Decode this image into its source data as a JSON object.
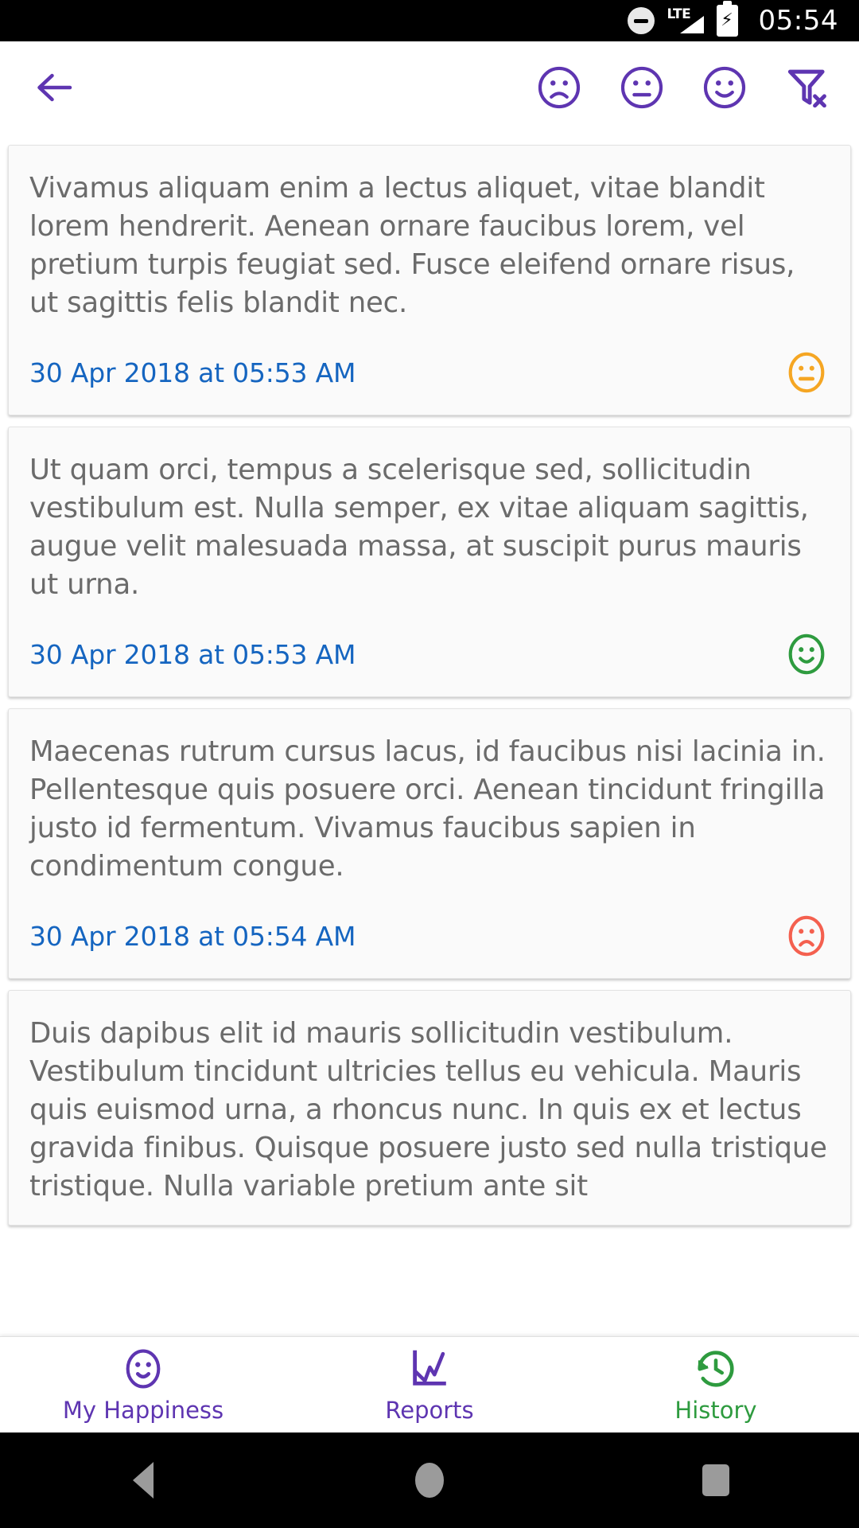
{
  "status_bar": {
    "dnd_icon": "do-not-disturb-icon",
    "network_label": "LTE",
    "signal_icon": "signal-bars-icon",
    "battery_icon": "battery-charging-icon",
    "time": "05:54"
  },
  "toolbar": {
    "back_icon": "back-arrow-icon",
    "accent_color": "#5e35b1",
    "actions": [
      {
        "name": "filter-sad-face-button",
        "icon": "sad-face-icon",
        "label": "Sad"
      },
      {
        "name": "filter-neutral-face-button",
        "icon": "neutral-face-icon",
        "label": "Neutral"
      },
      {
        "name": "filter-happy-face-button",
        "icon": "happy-face-icon",
        "label": "Happy"
      },
      {
        "name": "clear-filter-button",
        "icon": "filter-off-icon",
        "label": "Clear filter"
      }
    ]
  },
  "entries": [
    {
      "text": "Vivamus aliquam enim a lectus aliquet, vitae blandit lorem hendrerit. Aenean ornare faucibus lorem, vel pretium turpis feugiat sed. Fusce eleifend ornare risus, ut sagittis felis blandit nec.",
      "date": "30 Apr 2018 at 05:53 AM",
      "mood": "neutral",
      "mood_icon": "neutral-face-icon",
      "mood_color": "#f5a623"
    },
    {
      "text": "Ut quam orci, tempus a scelerisque sed, sollicitudin vestibulum est. Nulla semper, ex vitae aliquam sagittis, augue velit malesuada massa, at suscipit purus mauris ut urna.",
      "date": "30 Apr 2018 at 05:53 AM",
      "mood": "happy",
      "mood_icon": "happy-face-icon",
      "mood_color": "#2e9b3f"
    },
    {
      "text": "Maecenas rutrum cursus lacus, id faucibus nisi lacinia in. Pellentesque quis posuere orci. Aenean tincidunt fringilla justo id fermentum. Vivamus faucibus sapien in condimentum congue.",
      "date": "30 Apr 2018 at 05:54 AM",
      "mood": "sad",
      "mood_icon": "sad-face-icon",
      "mood_color": "#f4604f"
    },
    {
      "text": "Duis dapibus elit id mauris sollicitudin vestibulum. Vestibulum tincidunt ultricies tellus eu vehicula. Mauris quis euismod urna, a rhoncus nunc. In quis ex et lectus gravida finibus. Quisque posuere justo sed nulla tristique tristique. Nulla variable pretium ante sit",
      "date": "",
      "mood": "",
      "mood_icon": "",
      "mood_color": ""
    }
  ],
  "bottom_nav": {
    "items": [
      {
        "name": "nav-my-happiness",
        "label": "My Happiness",
        "icon": "happy-face-icon",
        "color": "#5e35b1",
        "active": false
      },
      {
        "name": "nav-reports",
        "label": "Reports",
        "icon": "line-chart-icon",
        "color": "#5e35b1",
        "active": false
      },
      {
        "name": "nav-history",
        "label": "History",
        "icon": "history-clock-icon",
        "color": "#2e9b3f",
        "active": true
      }
    ]
  },
  "system_nav": {
    "back": "system-back-button",
    "home": "system-home-button",
    "recents": "system-recents-button"
  }
}
